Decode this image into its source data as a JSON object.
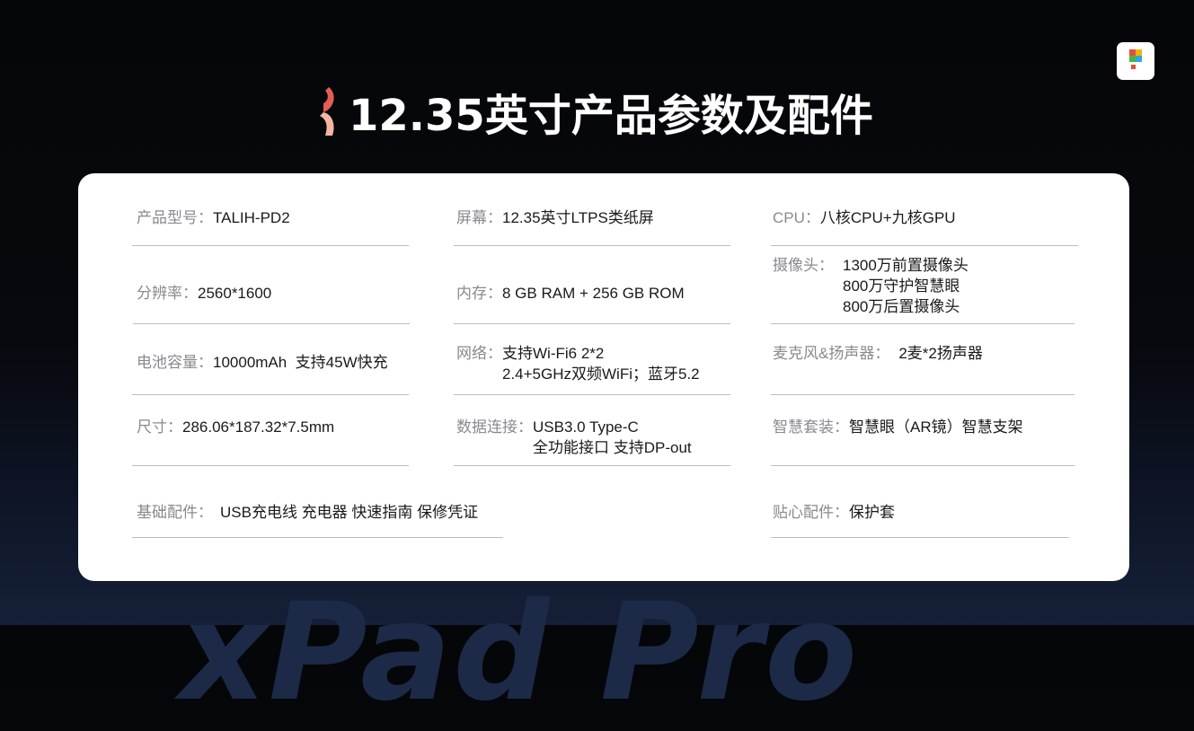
{
  "title": "12.35英寸产品参数及配件",
  "background_word": "xPad Pro",
  "colors": {
    "accent": "#e25f55",
    "accent_light": "#f2b6a2",
    "card": "#ffffff",
    "label": "#8a8a8e",
    "value": "#1a1a1a"
  },
  "specs": {
    "model": {
      "label": "产品型号：",
      "lines": [
        "TALIH-PD2"
      ]
    },
    "screen": {
      "label": "屏幕：",
      "lines": [
        "12.35英寸LTPS类纸屏"
      ]
    },
    "cpu": {
      "label": "CPU：",
      "lines": [
        "八核CPU+九核GPU"
      ]
    },
    "resolution": {
      "label": "分辨率：",
      "lines": [
        "2560*1600"
      ]
    },
    "memory": {
      "label": "内存：",
      "lines": [
        "8 GB RAM + 256 GB ROM"
      ]
    },
    "camera": {
      "label": "摄像头：",
      "lines": [
        "1300万前置摄像头",
        "800万守护智慧眼",
        "800万后置摄像头"
      ]
    },
    "battery": {
      "label": "电池容量：",
      "lines": [
        "10000mAh  支持45W快充"
      ]
    },
    "network": {
      "label": "网络：",
      "lines": [
        "支持Wi-Fi6 2*2",
        "2.4+5GHz双频WiFi；蓝牙5.2"
      ]
    },
    "audio": {
      "label": "麦克风&扬声器：",
      "lines": [
        "2麦*2扬声器"
      ]
    },
    "size": {
      "label": "尺寸：",
      "lines": [
        "286.06*187.32*7.5mm"
      ]
    },
    "connection": {
      "label": "数据连接：",
      "lines": [
        "USB3.0 Type-C",
        "全功能接口 支持DP-out"
      ]
    },
    "smart_kit": {
      "label": "智慧套装：",
      "lines": [
        "智慧眼（AR镜）智慧支架"
      ]
    },
    "basic_accessories": {
      "label": "基础配件：",
      "lines": [
        "USB充电线 充电器 快速指南 保修凭证"
      ]
    },
    "extra_accessories": {
      "label": "贴心配件：",
      "lines": [
        "保护套"
      ]
    }
  }
}
